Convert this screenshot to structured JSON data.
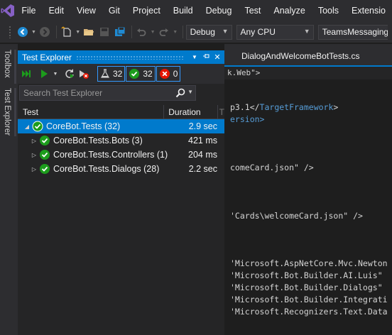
{
  "menu": [
    "File",
    "Edit",
    "View",
    "Git",
    "Project",
    "Build",
    "Debug",
    "Test",
    "Analyze",
    "Tools",
    "Extensio"
  ],
  "toolbar": {
    "config": "Debug",
    "platform": "Any CPU",
    "project": "TeamsMessaging"
  },
  "sidetabs": {
    "toolbox": "Toolbox",
    "test_explorer": "Test Explorer"
  },
  "panel": {
    "title": "Test Explorer",
    "counts": {
      "total": "32",
      "passed": "32",
      "failed": "0"
    },
    "search_placeholder": "Search Test Explorer",
    "columns": {
      "test": "Test",
      "duration": "Duration",
      "extra": "T"
    },
    "rows": [
      {
        "name": "CoreBot.Tests (32)",
        "duration": "2.9 sec"
      },
      {
        "name": "CoreBot.Tests.Bots (3)",
        "duration": "421 ms"
      },
      {
        "name": "CoreBot.Tests.Controllers (1)",
        "duration": "204 ms"
      },
      {
        "name": "CoreBot.Tests.Dialogs (28)",
        "duration": "2.2 sec"
      }
    ]
  },
  "editor": {
    "tab": "DialogAndWelcomeBotTests.cs",
    "breadcrumb": "k.Web\">",
    "lines": {
      "l1a": "p3.1</",
      "l1b": "TargetFramework",
      "l1c": ">",
      "l2": "ersion>",
      "l3": "comeCard.json\" />",
      "l4": "'Cards\\welcomeCard.json\" />",
      "l5": "'Microsoft.AspNetCore.Mvc.Newton",
      "l6": "'Microsoft.Bot.Builder.AI.Luis\"",
      "l7": "'Microsoft.Bot.Builder.Dialogs\"",
      "l8": "'Microsoft.Bot.Builder.Integrati",
      "l9": "'Microsoft.Recognizers.Text.Data"
    }
  },
  "colors": {
    "accent": "#007acc",
    "pass": "#1c9c1c",
    "fail": "#e51400",
    "background": "#1e1e1e"
  }
}
